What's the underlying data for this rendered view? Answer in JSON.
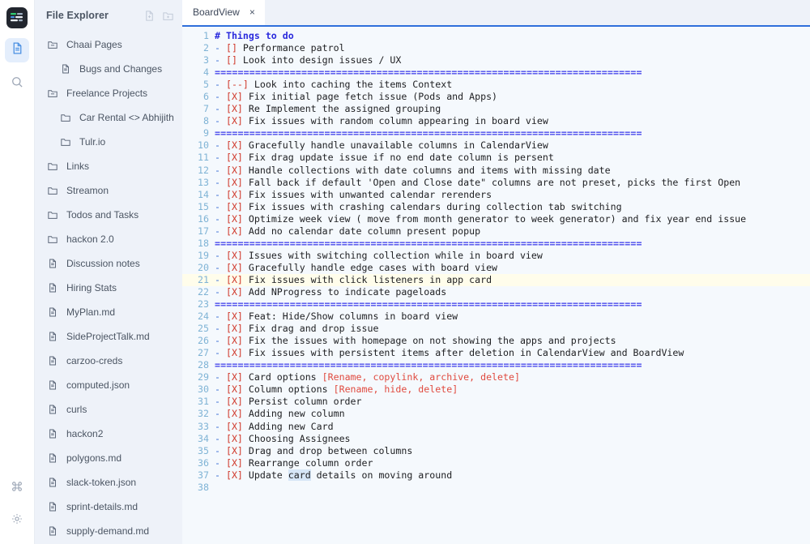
{
  "rail": {
    "logo_name": "app-logo",
    "items": [
      {
        "name": "files-icon",
        "label": "Files",
        "active": true
      },
      {
        "name": "search-icon",
        "label": "Search",
        "active": false
      }
    ],
    "bottom": [
      {
        "name": "command-icon",
        "label": "Commands"
      },
      {
        "name": "gear-icon",
        "label": "Settings"
      }
    ]
  },
  "explorer": {
    "title": "File Explorer",
    "new_file_label": "New File",
    "new_folder_label": "New Folder",
    "items": [
      {
        "label": "Chaai Pages",
        "type": "folder-open",
        "depth": 0
      },
      {
        "label": "Bugs and Changes",
        "type": "file",
        "depth": 1
      },
      {
        "label": "Freelance Projects",
        "type": "folder-open",
        "depth": 0
      },
      {
        "label": "Car Rental <> Abhijith",
        "type": "folder",
        "depth": 1
      },
      {
        "label": "Tulr.io",
        "type": "folder",
        "depth": 1
      },
      {
        "label": "Links",
        "type": "folder",
        "depth": 0
      },
      {
        "label": "Streamon",
        "type": "folder",
        "depth": 0
      },
      {
        "label": "Todos and Tasks",
        "type": "folder",
        "depth": 0
      },
      {
        "label": "hackon 2.0",
        "type": "folder",
        "depth": 0
      },
      {
        "label": "Discussion notes",
        "type": "file",
        "depth": 0
      },
      {
        "label": "Hiring Stats",
        "type": "file",
        "depth": 0
      },
      {
        "label": "MyPlan.md",
        "type": "file",
        "depth": 0
      },
      {
        "label": "SideProjectTalk.md",
        "type": "file",
        "depth": 0
      },
      {
        "label": "carzoo-creds",
        "type": "file",
        "depth": 0
      },
      {
        "label": "computed.json",
        "type": "file",
        "depth": 0
      },
      {
        "label": "curls",
        "type": "file",
        "depth": 0
      },
      {
        "label": "hackon2",
        "type": "file",
        "depth": 0
      },
      {
        "label": "polygons.md",
        "type": "file",
        "depth": 0
      },
      {
        "label": "slack-token.json",
        "type": "file",
        "depth": 0
      },
      {
        "label": "sprint-details.md",
        "type": "file",
        "depth": 0
      },
      {
        "label": "supply-demand.md",
        "type": "file",
        "depth": 0
      }
    ]
  },
  "tabs": [
    {
      "label": "BoardView",
      "close_label": "×",
      "active": true
    }
  ],
  "editor": {
    "highlight_line": 21,
    "colors": {
      "background": "#f5f9fd",
      "line_number": "#7fb3d5",
      "heading": "#2b2bdd",
      "separator": "#4a4aec",
      "dash": "#3b6fd4",
      "checkbox": "#d0392b",
      "bracket_text": "#e04a3f",
      "current_line": "#fffdeb",
      "selection": "#d6e6f7",
      "tab_underline": "#2f6fdb"
    },
    "separator_text": "==========================================================================",
    "lines": [
      {
        "n": 1,
        "tokens": [
          {
            "t": "head",
            "v": "# Things to do"
          }
        ]
      },
      {
        "n": 2,
        "tokens": [
          {
            "t": "dash",
            "v": "- "
          },
          {
            "t": "box",
            "v": "[]"
          },
          {
            "t": "plain",
            "v": " Performance patrol"
          }
        ]
      },
      {
        "n": 3,
        "tokens": [
          {
            "t": "dash",
            "v": "- "
          },
          {
            "t": "box",
            "v": "[]"
          },
          {
            "t": "plain",
            "v": " Look into design issues / UX"
          }
        ]
      },
      {
        "n": 4,
        "tokens": [
          {
            "t": "sep",
            "v": "=========================================================================="
          }
        ]
      },
      {
        "n": 5,
        "tokens": [
          {
            "t": "dash",
            "v": "- "
          },
          {
            "t": "box",
            "v": "[--]"
          },
          {
            "t": "plain",
            "v": " Look into caching the items Context"
          }
        ]
      },
      {
        "n": 6,
        "tokens": [
          {
            "t": "dash",
            "v": "- "
          },
          {
            "t": "box",
            "v": "[X]"
          },
          {
            "t": "plain",
            "v": " Fix initial page fetch issue (Pods and Apps)"
          }
        ]
      },
      {
        "n": 7,
        "tokens": [
          {
            "t": "dash",
            "v": "- "
          },
          {
            "t": "box",
            "v": "[X]"
          },
          {
            "t": "plain",
            "v": " Re Implement the assigned grouping"
          }
        ]
      },
      {
        "n": 8,
        "tokens": [
          {
            "t": "dash",
            "v": "- "
          },
          {
            "t": "box",
            "v": "[X]"
          },
          {
            "t": "plain",
            "v": " Fix issues with random column appearing in board view"
          }
        ]
      },
      {
        "n": 9,
        "tokens": [
          {
            "t": "sep",
            "v": "=========================================================================="
          }
        ]
      },
      {
        "n": 10,
        "tokens": [
          {
            "t": "dash",
            "v": "- "
          },
          {
            "t": "box",
            "v": "[X]"
          },
          {
            "t": "plain",
            "v": " Gracefully handle unavailable columns in CalendarView"
          }
        ]
      },
      {
        "n": 11,
        "tokens": [
          {
            "t": "dash",
            "v": "- "
          },
          {
            "t": "box",
            "v": "[X]"
          },
          {
            "t": "plain",
            "v": " Fix drag update issue if no end date column is persent"
          }
        ]
      },
      {
        "n": 12,
        "tokens": [
          {
            "t": "dash",
            "v": "- "
          },
          {
            "t": "box",
            "v": "[X]"
          },
          {
            "t": "plain",
            "v": " Handle collections with date columns and items with missing date"
          }
        ]
      },
      {
        "n": 13,
        "tokens": [
          {
            "t": "dash",
            "v": "- "
          },
          {
            "t": "box",
            "v": "[X]"
          },
          {
            "t": "plain",
            "v": " Fall back if default 'Open and Close date\" columns are not preset, picks the first Open"
          }
        ]
      },
      {
        "n": 14,
        "tokens": [
          {
            "t": "dash",
            "v": "- "
          },
          {
            "t": "box",
            "v": "[X]"
          },
          {
            "t": "plain",
            "v": " Fix issues with unwanted calendar rerenders"
          }
        ]
      },
      {
        "n": 15,
        "tokens": [
          {
            "t": "dash",
            "v": "- "
          },
          {
            "t": "box",
            "v": "[X]"
          },
          {
            "t": "plain",
            "v": " Fix issues with crashing calendars during collection tab switching"
          }
        ]
      },
      {
        "n": 16,
        "tokens": [
          {
            "t": "dash",
            "v": "- "
          },
          {
            "t": "box",
            "v": "[X]"
          },
          {
            "t": "plain",
            "v": " Optimize week view ( move from month generator to week generator) and fix year end issue"
          }
        ]
      },
      {
        "n": 17,
        "tokens": [
          {
            "t": "dash",
            "v": "- "
          },
          {
            "t": "box",
            "v": "[X]"
          },
          {
            "t": "plain",
            "v": " Add no calendar date column present popup"
          }
        ]
      },
      {
        "n": 18,
        "tokens": [
          {
            "t": "sep",
            "v": "=========================================================================="
          }
        ]
      },
      {
        "n": 19,
        "tokens": [
          {
            "t": "dash",
            "v": "- "
          },
          {
            "t": "box",
            "v": "[X]"
          },
          {
            "t": "plain",
            "v": " Issues with switching collection while in board view"
          }
        ]
      },
      {
        "n": 20,
        "tokens": [
          {
            "t": "dash",
            "v": "- "
          },
          {
            "t": "box",
            "v": "[X]"
          },
          {
            "t": "plain",
            "v": " Gracefully handle edge cases with board view"
          }
        ]
      },
      {
        "n": 21,
        "tokens": [
          {
            "t": "dash",
            "v": "- "
          },
          {
            "t": "box",
            "v": "[X]"
          },
          {
            "t": "plain",
            "v": " Fix issues with click listeners in app card"
          }
        ]
      },
      {
        "n": 22,
        "tokens": [
          {
            "t": "dash",
            "v": "- "
          },
          {
            "t": "box",
            "v": "[X]"
          },
          {
            "t": "plain",
            "v": " Add NProgress to indicate pageloads"
          }
        ]
      },
      {
        "n": 23,
        "tokens": [
          {
            "t": "sep",
            "v": "=========================================================================="
          }
        ]
      },
      {
        "n": 24,
        "tokens": [
          {
            "t": "dash",
            "v": "- "
          },
          {
            "t": "box",
            "v": "[X]"
          },
          {
            "t": "plain",
            "v": " Feat: Hide/Show columns in board view"
          }
        ]
      },
      {
        "n": 25,
        "tokens": [
          {
            "t": "dash",
            "v": "- "
          },
          {
            "t": "box",
            "v": "[X]"
          },
          {
            "t": "plain",
            "v": " Fix drag and drop issue"
          }
        ]
      },
      {
        "n": 26,
        "tokens": [
          {
            "t": "dash",
            "v": "- "
          },
          {
            "t": "box",
            "v": "[X]"
          },
          {
            "t": "plain",
            "v": " Fix the issues with homepage on not showing the apps and projects"
          }
        ]
      },
      {
        "n": 27,
        "tokens": [
          {
            "t": "dash",
            "v": "- "
          },
          {
            "t": "box",
            "v": "[X]"
          },
          {
            "t": "plain",
            "v": " Fix issues with persistent items after deletion in CalendarView and BoardView"
          }
        ]
      },
      {
        "n": 28,
        "tokens": [
          {
            "t": "sep",
            "v": "=========================================================================="
          }
        ]
      },
      {
        "n": 29,
        "tokens": [
          {
            "t": "dash",
            "v": "- "
          },
          {
            "t": "box",
            "v": "[X]"
          },
          {
            "t": "plain",
            "v": " Card options "
          },
          {
            "t": "red",
            "v": "[Rename, copylink, archive, delete]"
          }
        ]
      },
      {
        "n": 30,
        "tokens": [
          {
            "t": "dash",
            "v": "- "
          },
          {
            "t": "box",
            "v": "[X]"
          },
          {
            "t": "plain",
            "v": " Column options "
          },
          {
            "t": "red",
            "v": "[Rename, hide, delete]"
          }
        ]
      },
      {
        "n": 31,
        "tokens": [
          {
            "t": "dash",
            "v": "- "
          },
          {
            "t": "box",
            "v": "[X]"
          },
          {
            "t": "plain",
            "v": " Persist column order"
          }
        ]
      },
      {
        "n": 32,
        "tokens": [
          {
            "t": "dash",
            "v": "- "
          },
          {
            "t": "box",
            "v": "[X]"
          },
          {
            "t": "plain",
            "v": " Adding new column"
          }
        ]
      },
      {
        "n": 33,
        "tokens": [
          {
            "t": "dash",
            "v": "- "
          },
          {
            "t": "box",
            "v": "[X]"
          },
          {
            "t": "plain",
            "v": " Adding new Card"
          }
        ]
      },
      {
        "n": 34,
        "tokens": [
          {
            "t": "dash",
            "v": "- "
          },
          {
            "t": "box",
            "v": "[X]"
          },
          {
            "t": "plain",
            "v": " Choosing Assignees"
          }
        ]
      },
      {
        "n": 35,
        "tokens": [
          {
            "t": "dash",
            "v": "- "
          },
          {
            "t": "box",
            "v": "[X]"
          },
          {
            "t": "plain",
            "v": " Drag and drop between columns"
          }
        ]
      },
      {
        "n": 36,
        "tokens": [
          {
            "t": "dash",
            "v": "- "
          },
          {
            "t": "box",
            "v": "[X]"
          },
          {
            "t": "plain",
            "v": " Rearrange column order"
          }
        ]
      },
      {
        "n": 37,
        "tokens": [
          {
            "t": "dash",
            "v": "- "
          },
          {
            "t": "box",
            "v": "[X]"
          },
          {
            "t": "plain",
            "v": " Update "
          },
          {
            "t": "sel",
            "v": "card"
          },
          {
            "t": "plain",
            "v": " details on moving around"
          }
        ]
      },
      {
        "n": 38,
        "tokens": []
      }
    ]
  }
}
